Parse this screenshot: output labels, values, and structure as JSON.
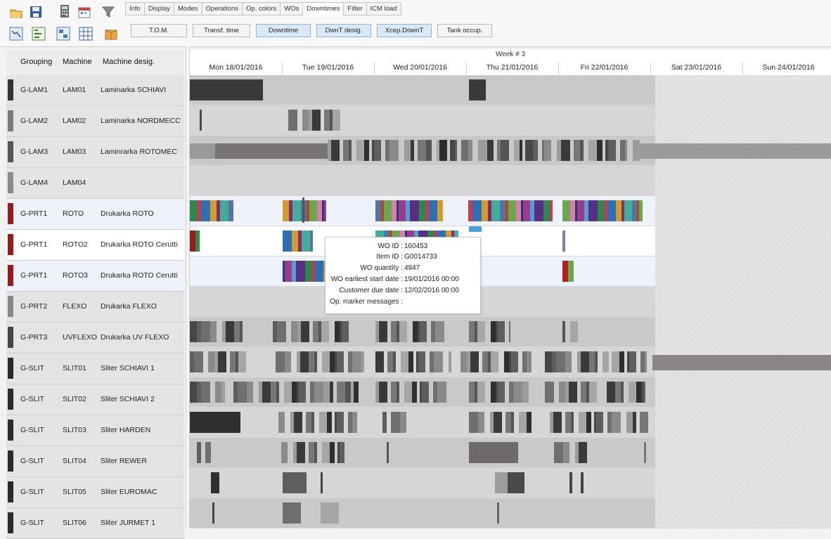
{
  "tabs": [
    "Info",
    "Display",
    "Modes",
    "Operations",
    "Op. colors",
    "WOs",
    "Downtimes",
    "Filter",
    "ICM load"
  ],
  "active_tab": "Downtimes",
  "view_buttons": [
    {
      "label": "T.O.M.",
      "active": false
    },
    {
      "label": "Transf. time",
      "active": false
    },
    {
      "label": "Downtime",
      "active": true
    },
    {
      "label": "DwnT desig.",
      "active": true
    },
    {
      "label": "Xcep.DownT",
      "active": true
    },
    {
      "label": "Tank occup.",
      "active": false
    }
  ],
  "toolbar_icons": [
    "open-folder-icon",
    "save-icon",
    "calculator-icon",
    "calendar-icon",
    "filter-icon",
    "gantt-chart-icon",
    "network-icon",
    "layout-icon",
    "grid-icon",
    "package-icon"
  ],
  "columns": {
    "grouping": "Grouping",
    "machine": "Machine",
    "desig": "Machine desig."
  },
  "timeline": {
    "week": "Week # 3",
    "days": [
      "Mon 18/01/2016",
      "Tue 19/01/2016",
      "Wed 20/01/2016",
      "Thu 21/01/2016",
      "Fri 22/01/2016",
      "Sat 23/01/2016",
      "Sun 24/01/2016"
    ]
  },
  "rows": [
    {
      "grouping": "G-LAM1",
      "machine": "LAM01",
      "desig": "Laminarka SCHIAVI",
      "color": "#333333"
    },
    {
      "grouping": "G-LAM2",
      "machine": "LAM02",
      "desig": "Laminarka NORDMECC",
      "color": "#7a7a7a"
    },
    {
      "grouping": "G-LAM3",
      "machine": "LAM03",
      "desig": "Laminrarka ROTOMEC",
      "color": "#555555"
    },
    {
      "grouping": "G-LAM4",
      "machine": "LAM04",
      "desig": "",
      "color": "#8a8a8a"
    },
    {
      "grouping": "G-PRT1",
      "machine": "ROTO",
      "desig": "Drukarka ROTO",
      "color": "#9b1b1b"
    },
    {
      "grouping": "G-PRT1",
      "machine": "ROTO2",
      "desig": "Drukarka ROTO Cerutti",
      "color": "#9b1b1b"
    },
    {
      "grouping": "G-PRT1",
      "machine": "ROTO3",
      "desig": "Drukarka ROTO Cerutti",
      "color": "#9b1b1b"
    },
    {
      "grouping": "G-PRT2",
      "machine": "FLEXO",
      "desig": "Drukarka FLEXO",
      "color": "#888888"
    },
    {
      "grouping": "G-PRT3",
      "machine": "UVFLEXO",
      "desig": "Drukarka UV FLEXO",
      "color": "#444444"
    },
    {
      "grouping": "G-SLIT",
      "machine": "SLIT01",
      "desig": "Sliter SCHIAVI 1",
      "color": "#2b2b2b"
    },
    {
      "grouping": "G-SLIT",
      "machine": "SLIT02",
      "desig": "Sliter SCHIAVI 2",
      "color": "#2b2b2b"
    },
    {
      "grouping": "G-SLIT",
      "machine": "SLIT03",
      "desig": "Sliter HARDEN",
      "color": "#2b2b2b"
    },
    {
      "grouping": "G-SLIT",
      "machine": "SLIT04",
      "desig": "Sliter REWER",
      "color": "#2b2b2b"
    },
    {
      "grouping": "G-SLIT",
      "machine": "SLIT05",
      "desig": "Sliter EUROMAC",
      "color": "#2b2b2b"
    },
    {
      "grouping": "G-SLIT",
      "machine": "SLIT06",
      "desig": "Sliter JURMET 1",
      "color": "#2b2b2b"
    }
  ],
  "tooltip": {
    "wo_id_label": "WO ID :",
    "wo_id": "160453",
    "item_id_label": "Item ID :",
    "item_id": "G0014733",
    "wo_qty_label": "WO quantity :",
    "wo_qty": "4947",
    "earliest_label": "WO earliest start date :",
    "earliest": "19/01/2016  00:00",
    "due_label": "Customer due date :",
    "due": "12/02/2016  00:00",
    "marker_label": "Op. marker messages :",
    "marker": ""
  }
}
